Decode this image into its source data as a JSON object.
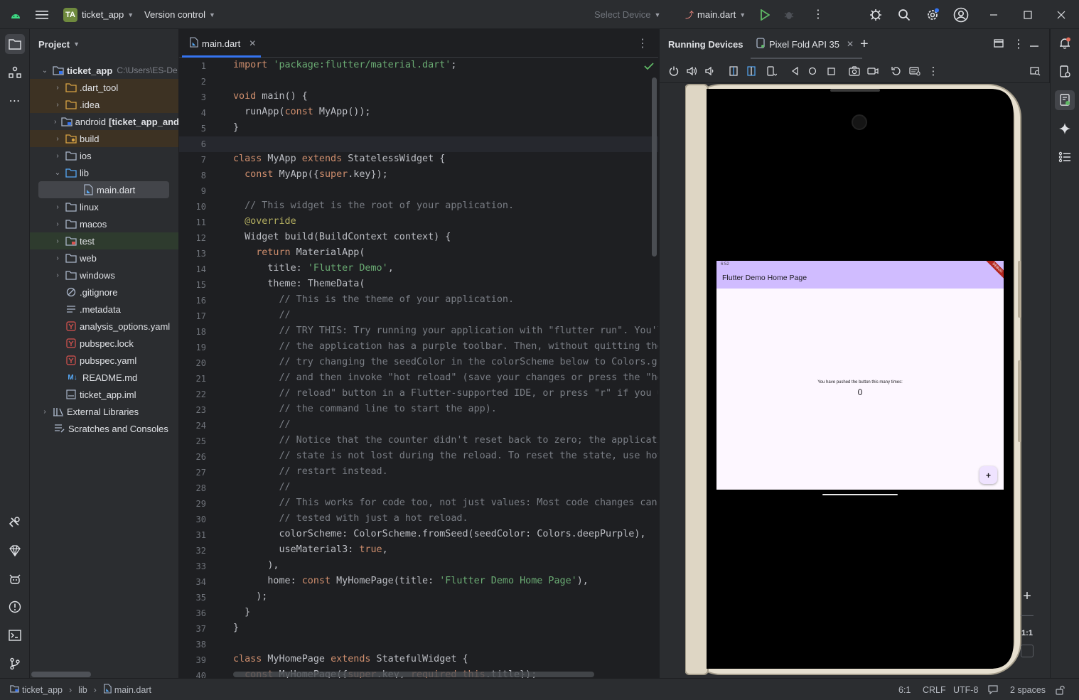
{
  "titlebar": {
    "project_badge": "TA",
    "project_name": "ticket_app",
    "vcs_label": "Version control",
    "device_selector": "Select Device",
    "run_config": "main.dart"
  },
  "project_panel": {
    "title": "Project",
    "root_name": "ticket_app",
    "root_path": "C:\\Users\\ES-De",
    "items": [
      {
        "name": ".dart_tool",
        "kind": "folder"
      },
      {
        "name": ".idea",
        "kind": "folder"
      },
      {
        "name": "android",
        "extra": "[ticket_app_and",
        "kind": "module"
      },
      {
        "name": "build",
        "kind": "folder"
      },
      {
        "name": "ios",
        "kind": "folder"
      },
      {
        "name": "lib",
        "kind": "folder"
      },
      {
        "name": "main.dart",
        "kind": "dart"
      },
      {
        "name": "linux",
        "kind": "folder"
      },
      {
        "name": "macos",
        "kind": "folder"
      },
      {
        "name": "test",
        "kind": "folder"
      },
      {
        "name": "web",
        "kind": "folder"
      },
      {
        "name": "windows",
        "kind": "folder"
      },
      {
        "name": ".gitignore",
        "kind": "ignore"
      },
      {
        "name": ".metadata",
        "kind": "text"
      },
      {
        "name": "analysis_options.yaml",
        "kind": "yaml"
      },
      {
        "name": "pubspec.lock",
        "kind": "yaml"
      },
      {
        "name": "pubspec.yaml",
        "kind": "yaml"
      },
      {
        "name": "README.md",
        "kind": "md"
      },
      {
        "name": "ticket_app.iml",
        "kind": "iml"
      },
      {
        "name": "External Libraries",
        "kind": "lib"
      },
      {
        "name": "Scratches and Consoles",
        "kind": "scratch"
      }
    ]
  },
  "editor": {
    "tab_label": "main.dart",
    "lines": [
      "import 'package:flutter/material.dart';",
      "",
      "void main() {",
      "  runApp(const MyApp());",
      "}",
      "",
      "class MyApp extends StatelessWidget {",
      "  const MyApp({super.key});",
      "",
      "  // This widget is the root of your application.",
      "  @override",
      "  Widget build(BuildContext context) {",
      "    return MaterialApp(",
      "      title: 'Flutter Demo',",
      "      theme: ThemeData(",
      "        // This is the theme of your application.",
      "        //",
      "        // TRY THIS: Try running your application with \"flutter run\". You'l",
      "        // the application has a purple toolbar. Then, without quitting the",
      "        // try changing the seedColor in the colorScheme below to Colors.gr",
      "        // and then invoke \"hot reload\" (save your changes or press the \"ho",
      "        // reload\" button in a Flutter-supported IDE, or press \"r\" if you u",
      "        // the command line to start the app).",
      "        //",
      "        // Notice that the counter didn't reset back to zero; the applicati",
      "        // state is not lost during the reload. To reset the state, use hot",
      "        // restart instead.",
      "        //",
      "        // This works for code too, not just values: Most code changes can",
      "        // tested with just a hot reload.",
      "        colorScheme: ColorScheme.fromSeed(seedColor: Colors.deepPurple),",
      "        useMaterial3: true,",
      "      ),",
      "      home: const MyHomePage(title: 'Flutter Demo Home Page'),",
      "    );",
      "  }",
      "}",
      "",
      "class MyHomePage extends StatefulWidget {",
      "  const MyHomePage({super.key, required this.title});"
    ]
  },
  "running_devices": {
    "title": "Running Devices",
    "device_tab": "Pixel Fold API 35",
    "zoom_label": "1:1"
  },
  "app": {
    "status_time": "6:52",
    "title": "Flutter Demo Home Page",
    "debug_banner": "DEBUG",
    "counter_label": "You have pushed the button this many times:",
    "counter_value": "0",
    "fab_label": "+"
  },
  "statusbar": {
    "breadcrumb": [
      "ticket_app",
      "lib",
      "main.dart"
    ],
    "position": "6:1",
    "line_ending": "CRLF",
    "encoding": "UTF-8",
    "indent": "2 spaces"
  },
  "colors": {
    "accent": "#3574f0",
    "app_bar": "#d0bcff",
    "app_bg": "#fdf7ff",
    "run_green": "#5fb865"
  }
}
